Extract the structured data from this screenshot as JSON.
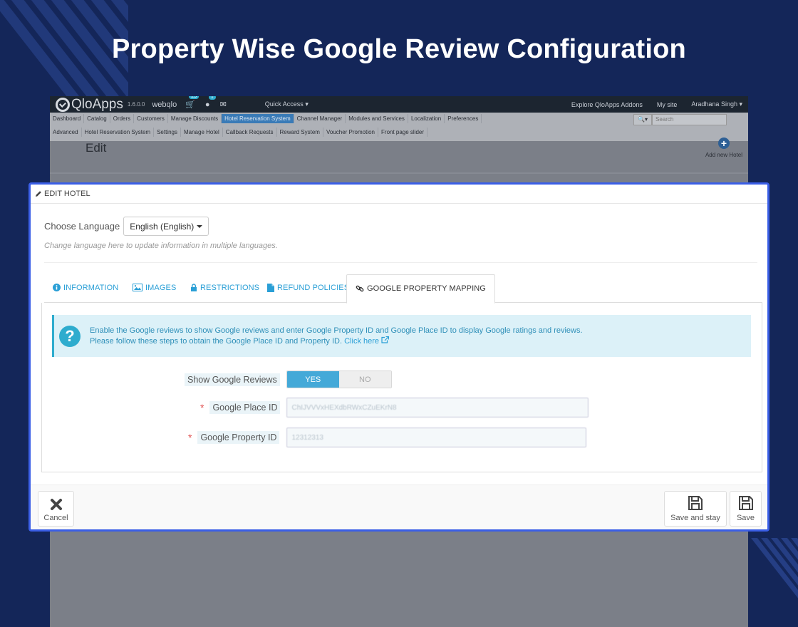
{
  "hero": {
    "title": "Property Wise Google Review Configuration"
  },
  "admin": {
    "brand": "QloApps",
    "version": "1.6.0.0",
    "shop_name": "webqlo",
    "orders_badge": "23",
    "customers_badge": "1",
    "quick_access": "Quick Access",
    "explore_addons": "Explore QloApps Addons",
    "my_site": "My site",
    "user": "Aradhana Singh",
    "menu_row1": [
      "Dashboard",
      "Catalog",
      "Orders",
      "Customers",
      "Manage Discounts",
      "Hotel Reservation System",
      "Channel Manager",
      "Modules and Services",
      "Localization",
      "Preferences"
    ],
    "menu_row1_active": "Hotel Reservation System",
    "menu_row2": [
      "Advanced",
      "Hotel Reservation System",
      "Settings",
      "Manage Hotel",
      "Callback Requests",
      "Reward System",
      "Voucher Promotion",
      "Front page slider"
    ],
    "search_placeholder": "Search",
    "page_heading": "Edit",
    "add_new": "Add new Hotel"
  },
  "card": {
    "header": "EDIT HOTEL",
    "language_label": "Choose Language",
    "language_value": "English (English)",
    "language_help": "Change language here to update information in multiple languages.",
    "tabs": [
      {
        "label": "INFORMATION",
        "icon": "info-icon"
      },
      {
        "label": "IMAGES",
        "icon": "image-icon"
      },
      {
        "label": "RESTRICTIONS",
        "icon": "lock-icon"
      },
      {
        "label": "REFUND POLICIES",
        "icon": "file-icon"
      },
      {
        "label": "GOOGLE PROPERTY MAPPING",
        "icon": "link-icon",
        "active": true
      }
    ],
    "alert_line1": "Enable the Google reviews to show Google reviews and enter Google Property ID and Google Place ID to display Google ratings and reviews.",
    "alert_line2": "Please follow these steps to obtain the Google Place ID and Property ID.",
    "alert_link": "Click here",
    "show_reviews_label": "Show Google Reviews",
    "toggle_yes": "YES",
    "toggle_no": "NO",
    "place_id_label": "Google Place ID",
    "place_id_value": "ChIJVVVxHEXdbRWxCZuEKrN8",
    "property_id_label": "Google Property ID",
    "property_id_value": "12312313",
    "required_mark": "*",
    "cancel": "Cancel",
    "save_and_stay": "Save and stay",
    "save": "Save"
  },
  "colors": {
    "background": "#142659",
    "card_border": "#3a5ee6",
    "accent": "#2eacce",
    "toggle_on": "#44a9d8"
  }
}
